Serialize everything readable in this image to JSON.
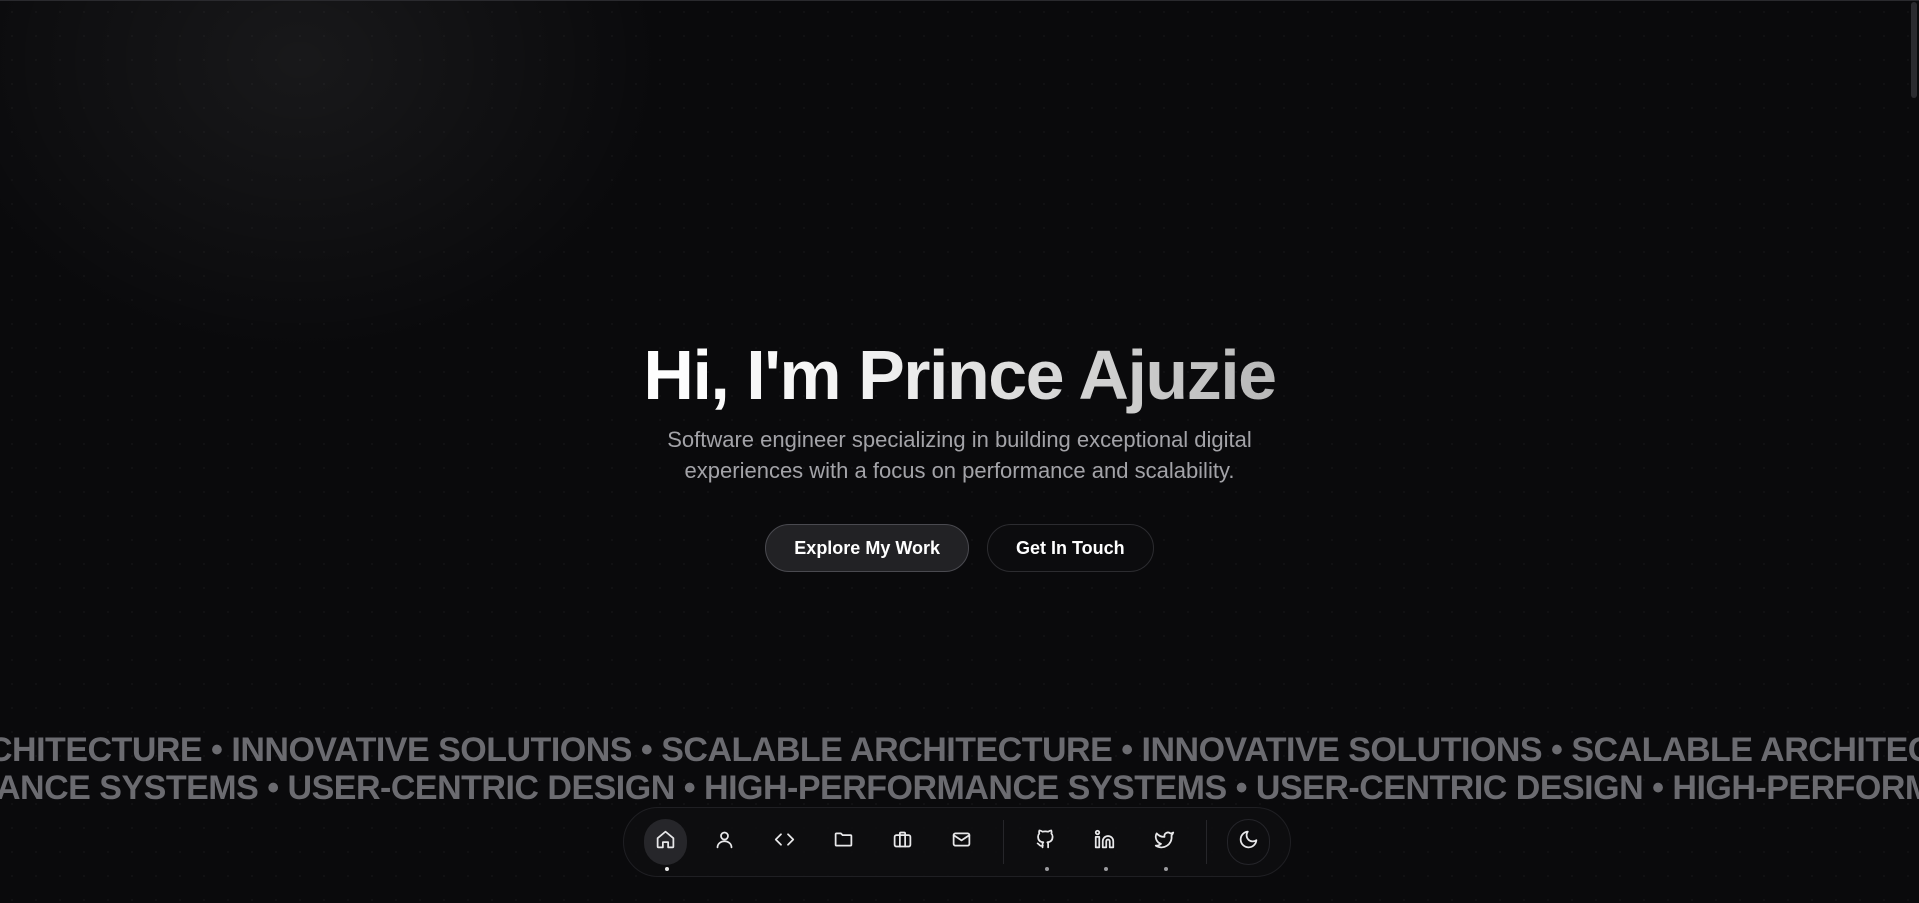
{
  "hero": {
    "title": "Hi, I'm Prince Ajuzie",
    "subtitle": "Software engineer specializing in building exceptional digital experiences with a focus on performance and scalability.",
    "primary_button": "Explore My Work",
    "secondary_button": "Get In Touch"
  },
  "marquee": {
    "row1": "CHITECTURE •    INNOVATIVE SOLUTIONS • SCALABLE ARCHITECTURE •    INNOVATIVE SOLUTIONS • SCALABLE ARCHITECTURE •    INNOVATIVE SOLUTIONS",
    "row2": "ANCE SYSTEMS • USER-CENTRIC DESIGN •    HIGH-PERFORMANCE SYSTEMS • USER-CENTRIC DESIGN •    HIGH-PERFORMANCE SYSTEMS • USER-CENTRIC DESIGN"
  },
  "dock": {
    "nav_items": [
      {
        "icon": "home-icon",
        "active": true
      },
      {
        "icon": "user-icon",
        "active": false
      },
      {
        "icon": "code-icon",
        "active": false
      },
      {
        "icon": "folder-icon",
        "active": false
      },
      {
        "icon": "briefcase-icon",
        "active": false
      },
      {
        "icon": "mail-icon",
        "active": false
      }
    ],
    "social_items": [
      {
        "icon": "github-icon"
      },
      {
        "icon": "linkedin-icon"
      },
      {
        "icon": "twitter-icon"
      }
    ],
    "theme_toggle_icon": "moon-icon"
  },
  "colors": {
    "background": "#0a0a0c",
    "subtitle_text": "#a3a3a8",
    "marquee_text": "#6b6b70",
    "button_primary_bg": "#222225"
  }
}
